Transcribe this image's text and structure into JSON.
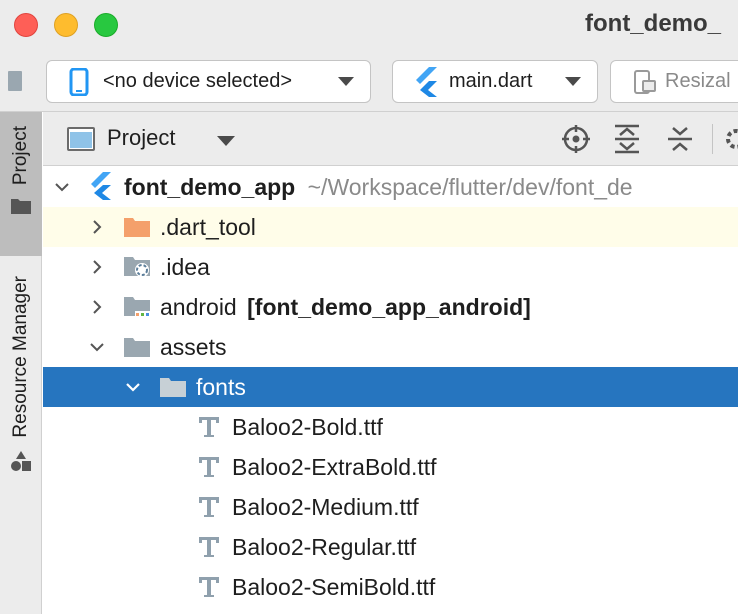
{
  "window": {
    "title": "font_demo_"
  },
  "toolbar": {
    "device_label": "<no device selected>",
    "run_config_label": "main.dart",
    "resize_label": "Resizal"
  },
  "stripe": {
    "project_label": "Project",
    "resource_manager_label": "Resource Manager"
  },
  "project_panel": {
    "view_label": "Project"
  },
  "tree": {
    "root": {
      "name": "font_demo_app",
      "path": "~/Workspace/flutter/dev/font_de"
    },
    "items": [
      {
        "label": ".dart_tool"
      },
      {
        "label": ".idea"
      },
      {
        "label": "android",
        "module": "[font_demo_app_android]"
      },
      {
        "label": "assets"
      },
      {
        "label": "fonts"
      },
      {
        "label": "Baloo2-Bold.ttf"
      },
      {
        "label": "Baloo2-ExtraBold.ttf"
      },
      {
        "label": "Baloo2-Medium.ttf"
      },
      {
        "label": "Baloo2-Regular.ttf"
      },
      {
        "label": "Baloo2-SemiBold.ttf"
      }
    ]
  },
  "colors": {
    "selection": "#2675bf",
    "highlight_row": "#fffde9",
    "excluded_folder": "#f4a06b",
    "folder": "#9aa7b0",
    "flutter_blue": "#42a5f5",
    "device_icon": "#2196f3"
  }
}
